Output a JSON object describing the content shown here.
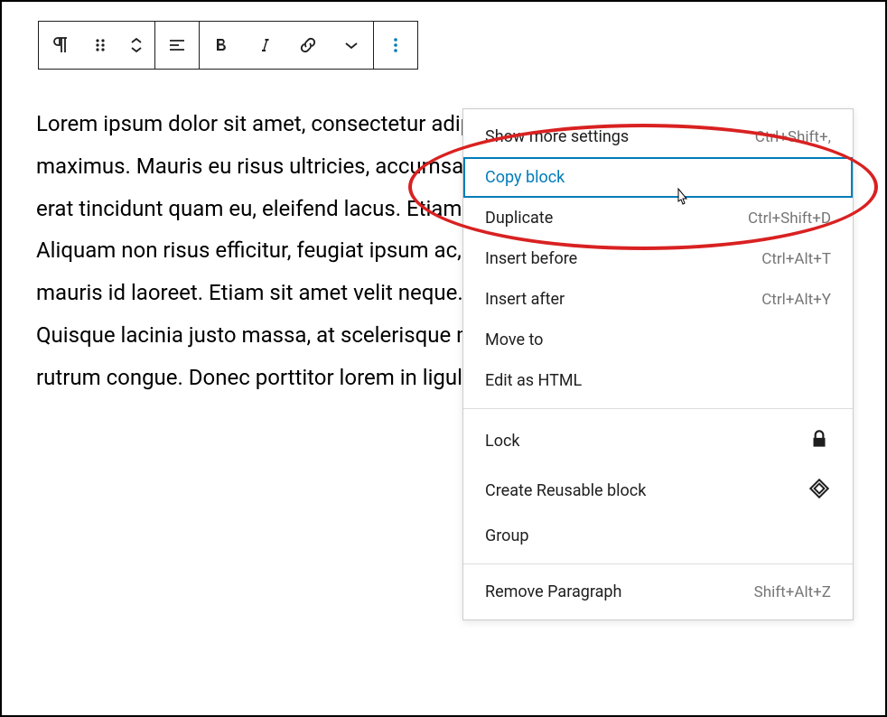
{
  "content_text": "Lorem ipsum dolor sit amet, consectetur adipiscing elit. Sed maximus et sapien ut maximus. Mauris eu risus ultricies, accumsan ante euismod vitae. Nullam dignissim, erat tincidunt quam eu, eleifend lacus. Etiam consequat elementum pulvinar. Aliquam non risus efficitur, feugiat ipsum ac, consequat eros. Morbi pulvinar sed mauris id laoreet. Etiam sit amet velit neque. Vivamus sit amet volutpat dolor. Quisque lacinia justo massa, at scelerisque mi vehicula vel. Aenean pellentesque rutrum congue. Donec porttitor lorem in ligula finibus vel tincidunt nulla.",
  "menu": {
    "section1": [
      {
        "label": "Show more settings",
        "shortcut": "Ctrl+Shift+,"
      },
      {
        "label": "Copy block",
        "shortcut": "",
        "highlighted": true
      },
      {
        "label": "Duplicate",
        "shortcut": "Ctrl+Shift+D"
      },
      {
        "label": "Insert before",
        "shortcut": "Ctrl+Alt+T"
      },
      {
        "label": "Insert after",
        "shortcut": "Ctrl+Alt+Y"
      },
      {
        "label": "Move to",
        "shortcut": ""
      },
      {
        "label": "Edit as HTML",
        "shortcut": ""
      }
    ],
    "section2": [
      {
        "label": "Lock",
        "icon": "lock"
      },
      {
        "label": "Create Reusable block",
        "icon": "reusable"
      },
      {
        "label": "Group",
        "icon": ""
      }
    ],
    "section3": [
      {
        "label": "Remove Paragraph",
        "shortcut": "Shift+Alt+Z"
      }
    ]
  }
}
